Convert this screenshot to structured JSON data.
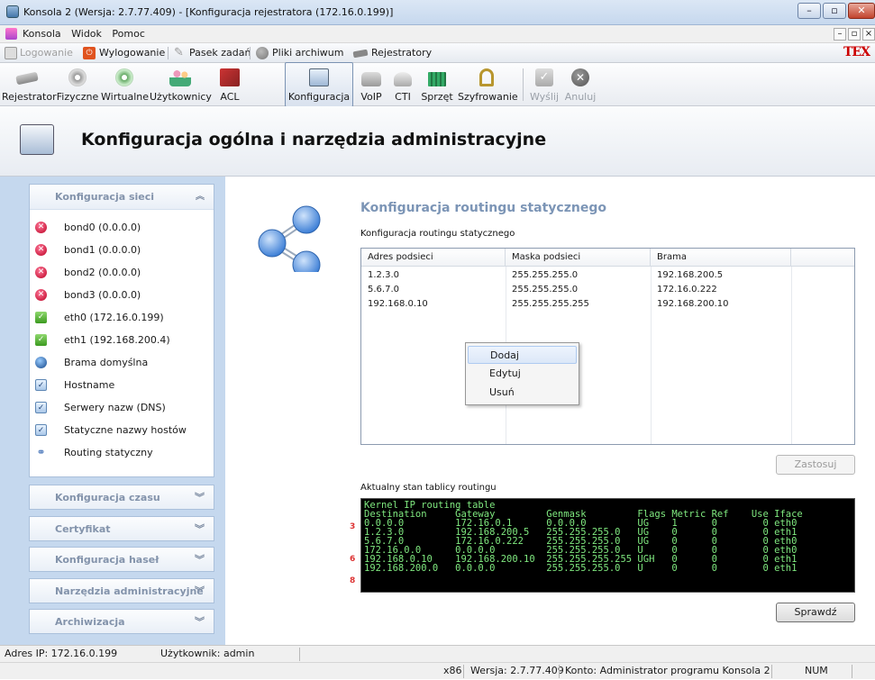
{
  "window": {
    "title": "Konsola 2 (Wersja:  2.7.77.409) - [Konfiguracja rejestratora (172.16.0.199)]",
    "controls": [
      "–",
      "▫",
      "✕"
    ]
  },
  "menu": {
    "items": [
      "Konsola",
      "Widok",
      "Pomoc"
    ],
    "mdi_controls": [
      "–",
      "▫",
      "×"
    ]
  },
  "toolbar1": {
    "logowanie": "Logowanie",
    "wylogowanie": "Wylogowanie",
    "pasek": "Pasek zadań",
    "pliki": "Pliki archiwum",
    "rejestratory": "Rejestratory",
    "brand": "TEX"
  },
  "toolbar2": {
    "items": [
      {
        "label": "Rejestrator",
        "icon": "recorder-icon"
      },
      {
        "label": "Fizyczne",
        "icon": "physical-disk-icon"
      },
      {
        "label": "Wirtualne",
        "icon": "virtual-disk-icon"
      },
      {
        "label": "Użytkownicy",
        "icon": "users-icon"
      },
      {
        "label": "ACL",
        "icon": "acl-icon"
      },
      {
        "label": "Konfiguracja",
        "icon": "config-icon"
      },
      {
        "label": "VoIP",
        "icon": "voip-icon"
      },
      {
        "label": "CTI",
        "icon": "cti-icon"
      },
      {
        "label": "Sprzęt",
        "icon": "hardware-icon"
      },
      {
        "label": "Szyfrowanie",
        "icon": "encryption-icon"
      },
      {
        "label": "Wyślij",
        "icon": "send-icon"
      },
      {
        "label": "Anuluj",
        "icon": "cancel-icon"
      }
    ]
  },
  "header": {
    "title": "Konfiguracja ogólna i narzędzia administracyjne"
  },
  "sidebar": {
    "section_open": "Konfiguracja sieci",
    "items": [
      {
        "label": "bond0 (0.0.0.0)",
        "status": "error"
      },
      {
        "label": "bond1 (0.0.0.0)",
        "status": "error"
      },
      {
        "label": "bond2 (0.0.0.0)",
        "status": "error"
      },
      {
        "label": "bond3 (0.0.0.0)",
        "status": "error"
      },
      {
        "label": "eth0 (172.16.0.199)",
        "status": "ok"
      },
      {
        "label": "eth1 (192.168.200.4)",
        "status": "ok"
      },
      {
        "label": "Brama domyślna",
        "status": "globe"
      },
      {
        "label": "Hostname",
        "status": "doc"
      },
      {
        "label": "Serwery nazw (DNS)",
        "status": "doc"
      },
      {
        "label": "Statyczne nazwy hostów",
        "status": "doc"
      },
      {
        "label": "Routing statyczny",
        "status": "route"
      }
    ],
    "collapsed": [
      "Konfiguracja czasu",
      "Certyfikat",
      "Konfiguracja haseł",
      "Narzędzia administracyjne",
      "Archiwizacja"
    ]
  },
  "main": {
    "section_title": "Konfiguracja routingu statycznego",
    "table_label": "Konfiguracja routingu statycznego",
    "columns": [
      "Adres podsieci",
      "Maska podsieci",
      "Brama"
    ],
    "rows": [
      [
        "1.2.3.0",
        "255.255.255.0",
        "192.168.200.5"
      ],
      [
        "5.6.7.0",
        "255.255.255.0",
        "172.16.0.222"
      ],
      [
        "192.168.0.10",
        "255.255.255.255",
        "192.168.200.10"
      ]
    ],
    "context_menu": [
      "Dodaj",
      "Edytuj",
      "Usuń"
    ],
    "apply_button": "Zastosuj",
    "routing_label": "Aktualny stan tablicy routingu",
    "terminal_lines": [
      "Kernel IP routing table",
      "Destination     Gateway         Genmask         Flags Metric Ref    Use Iface",
      "0.0.0.0         172.16.0.1      0.0.0.0         UG    1      0        0 eth0",
      "1.2.3.0         192.168.200.5   255.255.255.0   UG    0      0        0 eth1",
      "5.6.7.0         172.16.0.222    255.255.255.0   UG    0      0        0 eth0",
      "172.16.0.0      0.0.0.0         255.255.255.0   U     0      0        0 eth0",
      "192.168.0.10    192.168.200.10  255.255.255.255 UGH   0      0        0 eth1",
      "192.168.200.0   0.0.0.0         255.255.255.0   U     0      0        0 eth1"
    ],
    "line_markers": [
      "3",
      "6",
      "8"
    ],
    "check_button": "Sprawdź"
  },
  "status": {
    "ip": "Adres IP: 172.16.0.199",
    "user": "Użytkownik: admin",
    "arch": "x86",
    "version": "Wersja: 2.7.77.409",
    "account": "Konto: Administrator programu Konsola 2",
    "num": "NUM"
  },
  "colors": {
    "accent": "#7c95b6",
    "sidebar_bg": "#c5d8ee",
    "terminal_fg": "#7fe87f"
  }
}
